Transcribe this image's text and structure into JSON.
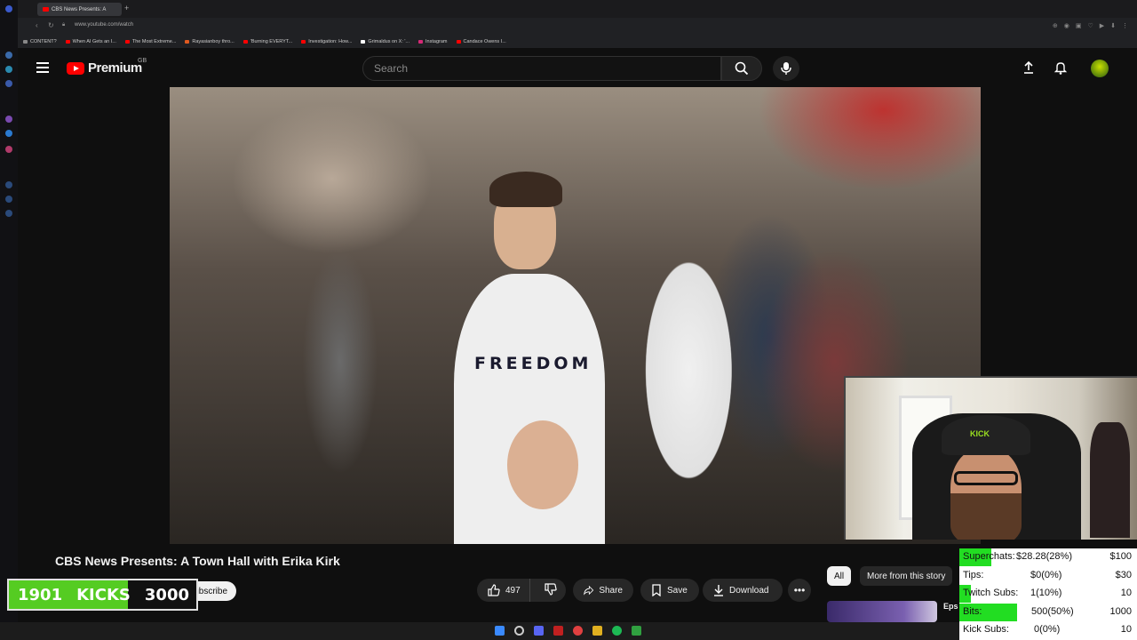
{
  "browser": {
    "tab_title": "CBS News Presents: A",
    "new_tab": "+",
    "url": "www.youtube.com/watch",
    "bookmarks": [
      {
        "label": "CONTENT?",
        "color": "#888888"
      },
      {
        "label": "When AI Gets an I...",
        "color": "#ff0000"
      },
      {
        "label": "The Most Extreme...",
        "color": "#ff0000"
      },
      {
        "label": "Rayasianboy thro...",
        "color": "#e05a20"
      },
      {
        "label": "'Burning EVERYT...",
        "color": "#ff0000"
      },
      {
        "label": "Investigation: How...",
        "color": "#ff0000"
      },
      {
        "label": "Grimaldus on X: '...",
        "color": "#ffffff"
      },
      {
        "label": "Instagram",
        "color": "#d62976"
      },
      {
        "label": "Candace Owens I...",
        "color": "#ff0000"
      }
    ]
  },
  "youtube": {
    "logo_text": "Premium",
    "logo_region": "GB",
    "search_placeholder": "Search",
    "icons": {
      "menu": "hamburger-icon",
      "search": "search-icon",
      "mic": "mic-icon",
      "upload": "upload-icon",
      "notifications": "bell-icon"
    }
  },
  "video": {
    "shirt_text": "FREEDOM",
    "title": "CBS News Presents: A Town Hall with Erika Kirk",
    "like_count": "497",
    "share_label": "Share",
    "save_label": "Save",
    "download_label": "Download",
    "subscribe_label": "Subscribe"
  },
  "recommendations": {
    "chip_all": "All",
    "chip_more": "More from this story",
    "next_title_fragment": "Eps"
  },
  "kicks_goal": {
    "current": "1901",
    "label": "KICKS",
    "goal": "3000",
    "progress": 0.634
  },
  "webcam": {
    "cap_text": "KICK"
  },
  "stream_stats": [
    {
      "label": "Superchats:",
      "value": "$28.28(28%)",
      "goal": "$100",
      "progress": 0.28
    },
    {
      "label": "Tips:",
      "value": "$0(0%)",
      "goal": "$30",
      "progress": 0
    },
    {
      "label": "Twitch Subs:",
      "value": "1(10%)",
      "goal": "10",
      "progress": 0.1
    },
    {
      "label": "Bits:",
      "value": "500(50%)",
      "goal": "1000",
      "progress": 0.5
    },
    {
      "label": "Kick Subs:",
      "value": "0(0%)",
      "goal": "10",
      "progress": 0
    }
  ]
}
